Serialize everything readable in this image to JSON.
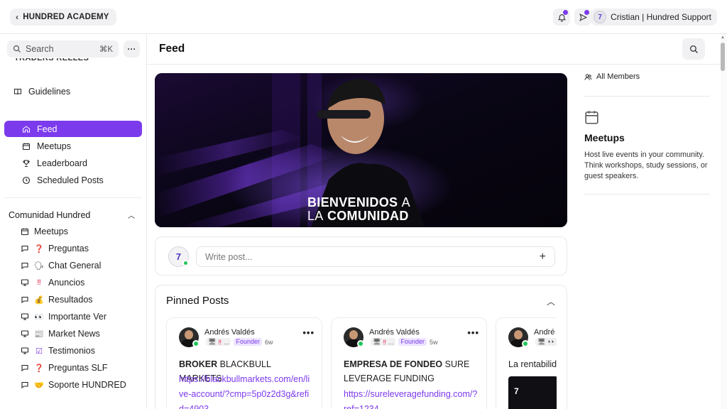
{
  "topbar": {
    "brand": "HUNDRED ACADEMY",
    "user_name": "Cristian | Hundred Support",
    "accent": "#7c3aed"
  },
  "sidebar": {
    "search_placeholder": "Search",
    "search_shortcut": "⌘K",
    "clipped_label": "TRADERS RELLES",
    "items": [
      {
        "label": "Guidelines",
        "icon": "book-icon"
      },
      {
        "label": "Feed",
        "icon": "home-icon",
        "active": true
      },
      {
        "label": "Meetups",
        "icon": "calendar-icon"
      },
      {
        "label": "Leaderboard",
        "icon": "trophy-icon"
      },
      {
        "label": "Scheduled Posts",
        "icon": "clock-icon"
      }
    ],
    "section_title": "Comunidad Hundred",
    "channels": [
      {
        "label": "Meetups",
        "icon": "calendar-icon",
        "emoji": ""
      },
      {
        "label": "Preguntas",
        "icon": "chat-icon",
        "emoji": "❓"
      },
      {
        "label": "Chat General",
        "icon": "chat-icon",
        "emoji": "🗣"
      },
      {
        "label": "Anuncios",
        "icon": "monitor-icon",
        "emoji": "‼"
      },
      {
        "label": "Resultados",
        "icon": "chat-icon",
        "emoji": "💰"
      },
      {
        "label": "Importante Ver",
        "icon": "monitor-icon",
        "emoji": "👀"
      },
      {
        "label": "Market News",
        "icon": "monitor-icon",
        "emoji": "📰"
      },
      {
        "label": "Testimonios",
        "icon": "monitor-icon",
        "emoji": "☑"
      },
      {
        "label": "Preguntas SLF",
        "icon": "chat-icon",
        "emoji": "❓"
      },
      {
        "label": "Soporte HUNDRED",
        "icon": "chat-icon",
        "emoji": "🤝"
      }
    ]
  },
  "main": {
    "title": "Feed",
    "banner": {
      "line1": "BIENVENIDOS",
      "line1b": "A",
      "line2a": "LA",
      "line2b": "COMUNIDAD"
    },
    "composer_placeholder": "Write post...",
    "composer_avatar": "7",
    "pinned_title": "Pinned Posts",
    "cards": [
      {
        "author": "Andrés Valdés",
        "badge": "Founder",
        "age": "6w",
        "meta_text": "...",
        "title_bold": "BROKER",
        "title_rest": " BLACKBULL MARKETS",
        "link": "https://blackbullmarkets.com/en/live-account/?cmp=5p0z2d3g&refid=4903"
      },
      {
        "author": "Andrés Valdés",
        "badge": "Founder",
        "age": "5w",
        "meta_text": "...",
        "title_bold": "EMPRESA DE FONDEO",
        "title_rest": " SURE LEVERAGE FUNDING",
        "link": "https://sureleveragefunding.com/?ref=1234"
      },
      {
        "author": "André",
        "badge": "",
        "age": "",
        "meta_text": "",
        "title_bold": "",
        "title_rest": "La rentabilid",
        "link": ""
      }
    ]
  },
  "rail": {
    "all_members": "All Members",
    "meetups_title": "Meetups",
    "meetups_desc": "Host live events in your community. Think workshops, study sessions, or guest speakers."
  }
}
